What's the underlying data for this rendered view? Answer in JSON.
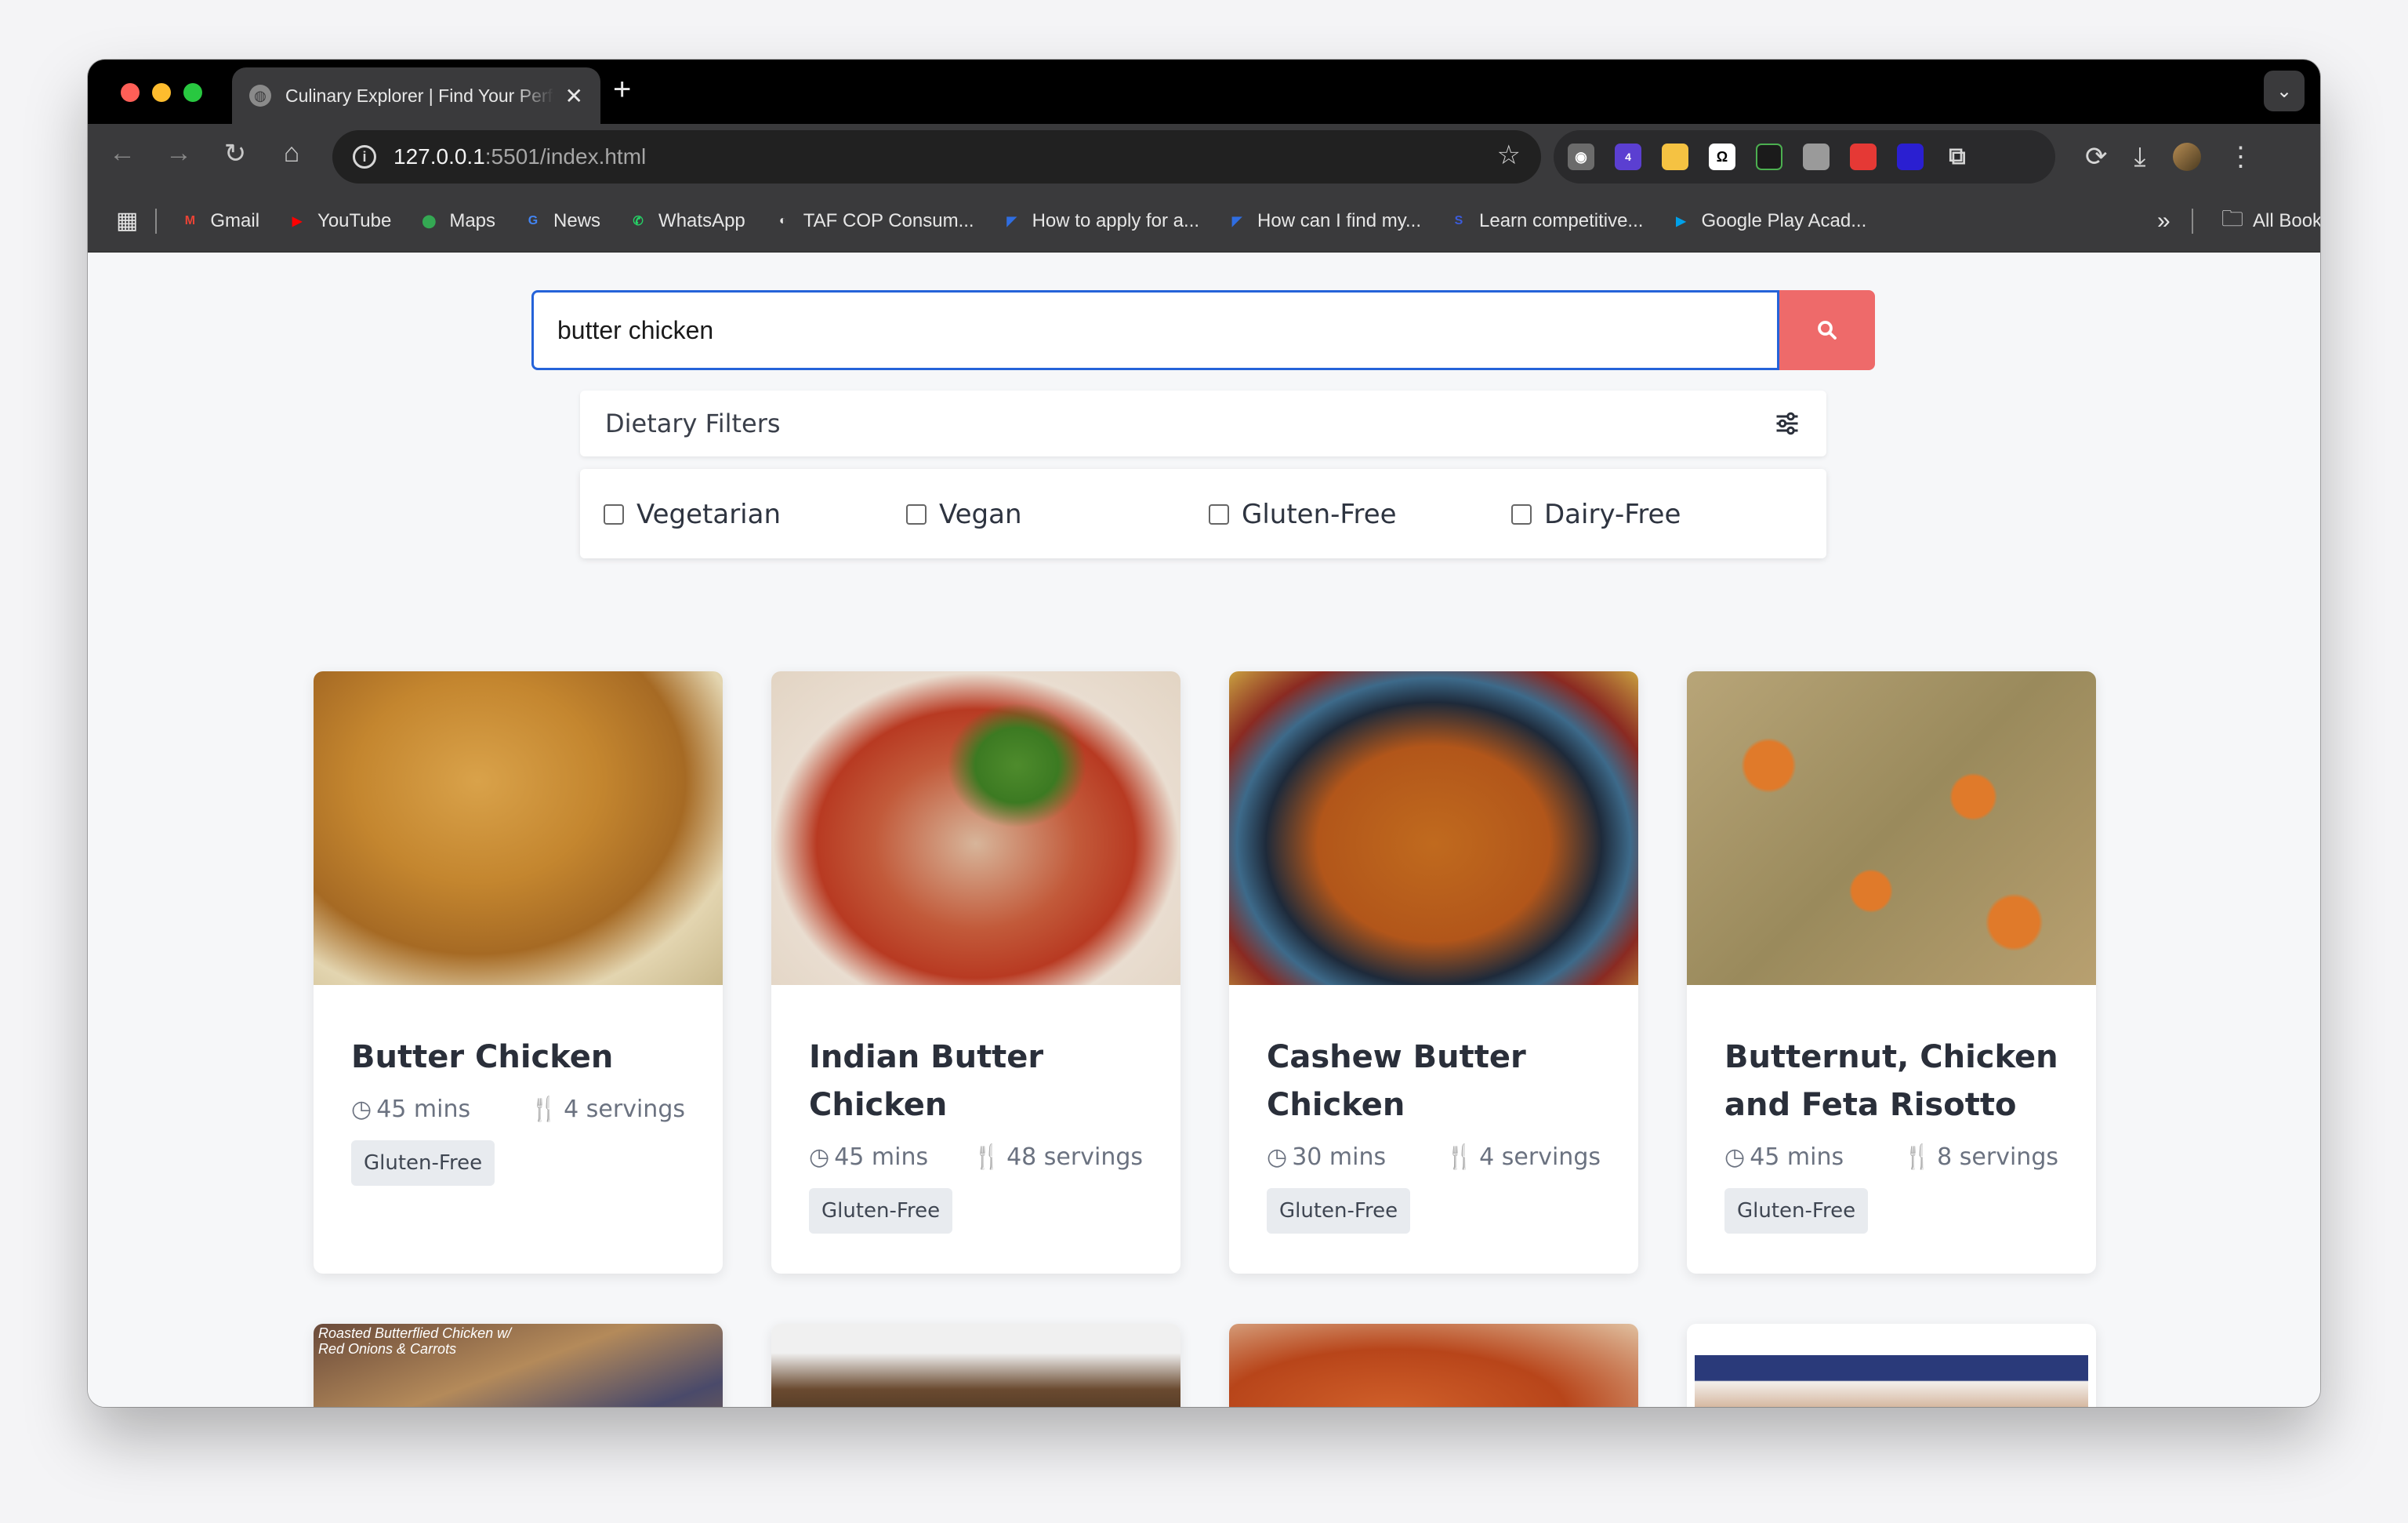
{
  "browser": {
    "tab_title": "Culinary Explorer | Find Your Perfect Recipe",
    "url_host": "127.0.0.1",
    "url_path": ":5501/index.html",
    "extension_badge": "4",
    "bookmarks": [
      {
        "label": "Gmail",
        "icon": "gmail-icon",
        "color": "#ea4335",
        "glyph": "M"
      },
      {
        "label": "YouTube",
        "icon": "youtube-icon",
        "color": "#ff0000",
        "glyph": "▶"
      },
      {
        "label": "Maps",
        "icon": "maps-icon",
        "color": "#34a853",
        "glyph": "⬤"
      },
      {
        "label": "News",
        "icon": "news-icon",
        "color": "#4285f4",
        "glyph": "G"
      },
      {
        "label": "WhatsApp",
        "icon": "whatsapp-icon",
        "color": "#25d366",
        "glyph": "✆"
      },
      {
        "label": "TAF COP Consum...",
        "icon": "globe-icon",
        "color": "#e6e6e6",
        "glyph": "◐"
      },
      {
        "label": "How to apply for a...",
        "icon": "doc-icon",
        "color": "#2f6de1",
        "glyph": "◤"
      },
      {
        "label": "How can I find my...",
        "icon": "doc-icon",
        "color": "#2f6de1",
        "glyph": "◤"
      },
      {
        "label": "Learn competitive...",
        "icon": "course-icon",
        "color": "#3b5bdb",
        "glyph": "S"
      },
      {
        "label": "Google Play Acad...",
        "icon": "play-icon",
        "color": "#00a0e9",
        "glyph": "▶"
      }
    ],
    "all_bookmarks": "All Bookmarks",
    "overflow": "»"
  },
  "search": {
    "value": "butter chicken",
    "button_color": "#ee6a6a"
  },
  "filters": {
    "title": "Dietary Filters",
    "options": [
      "Vegetarian",
      "Vegan",
      "Gluten-Free",
      "Dairy-Free"
    ]
  },
  "recipes": [
    {
      "title": "Butter Chicken",
      "time": "45 mins",
      "servings": "4 servings",
      "tag": "Gluten-Free"
    },
    {
      "title": "Indian Butter Chicken",
      "time": "45 mins",
      "servings": "48 servings",
      "tag": "Gluten-Free"
    },
    {
      "title": "Cashew Butter Chicken",
      "time": "30 mins",
      "servings": "4 servings",
      "tag": "Gluten-Free"
    },
    {
      "title": "Butternut, Chicken and Feta Risotto",
      "time": "45 mins",
      "servings": "8 servings",
      "tag": "Gluten-Free"
    }
  ],
  "second_row_caption": "Roasted Butterflied Chicken w/ Red Onions & Carrots"
}
